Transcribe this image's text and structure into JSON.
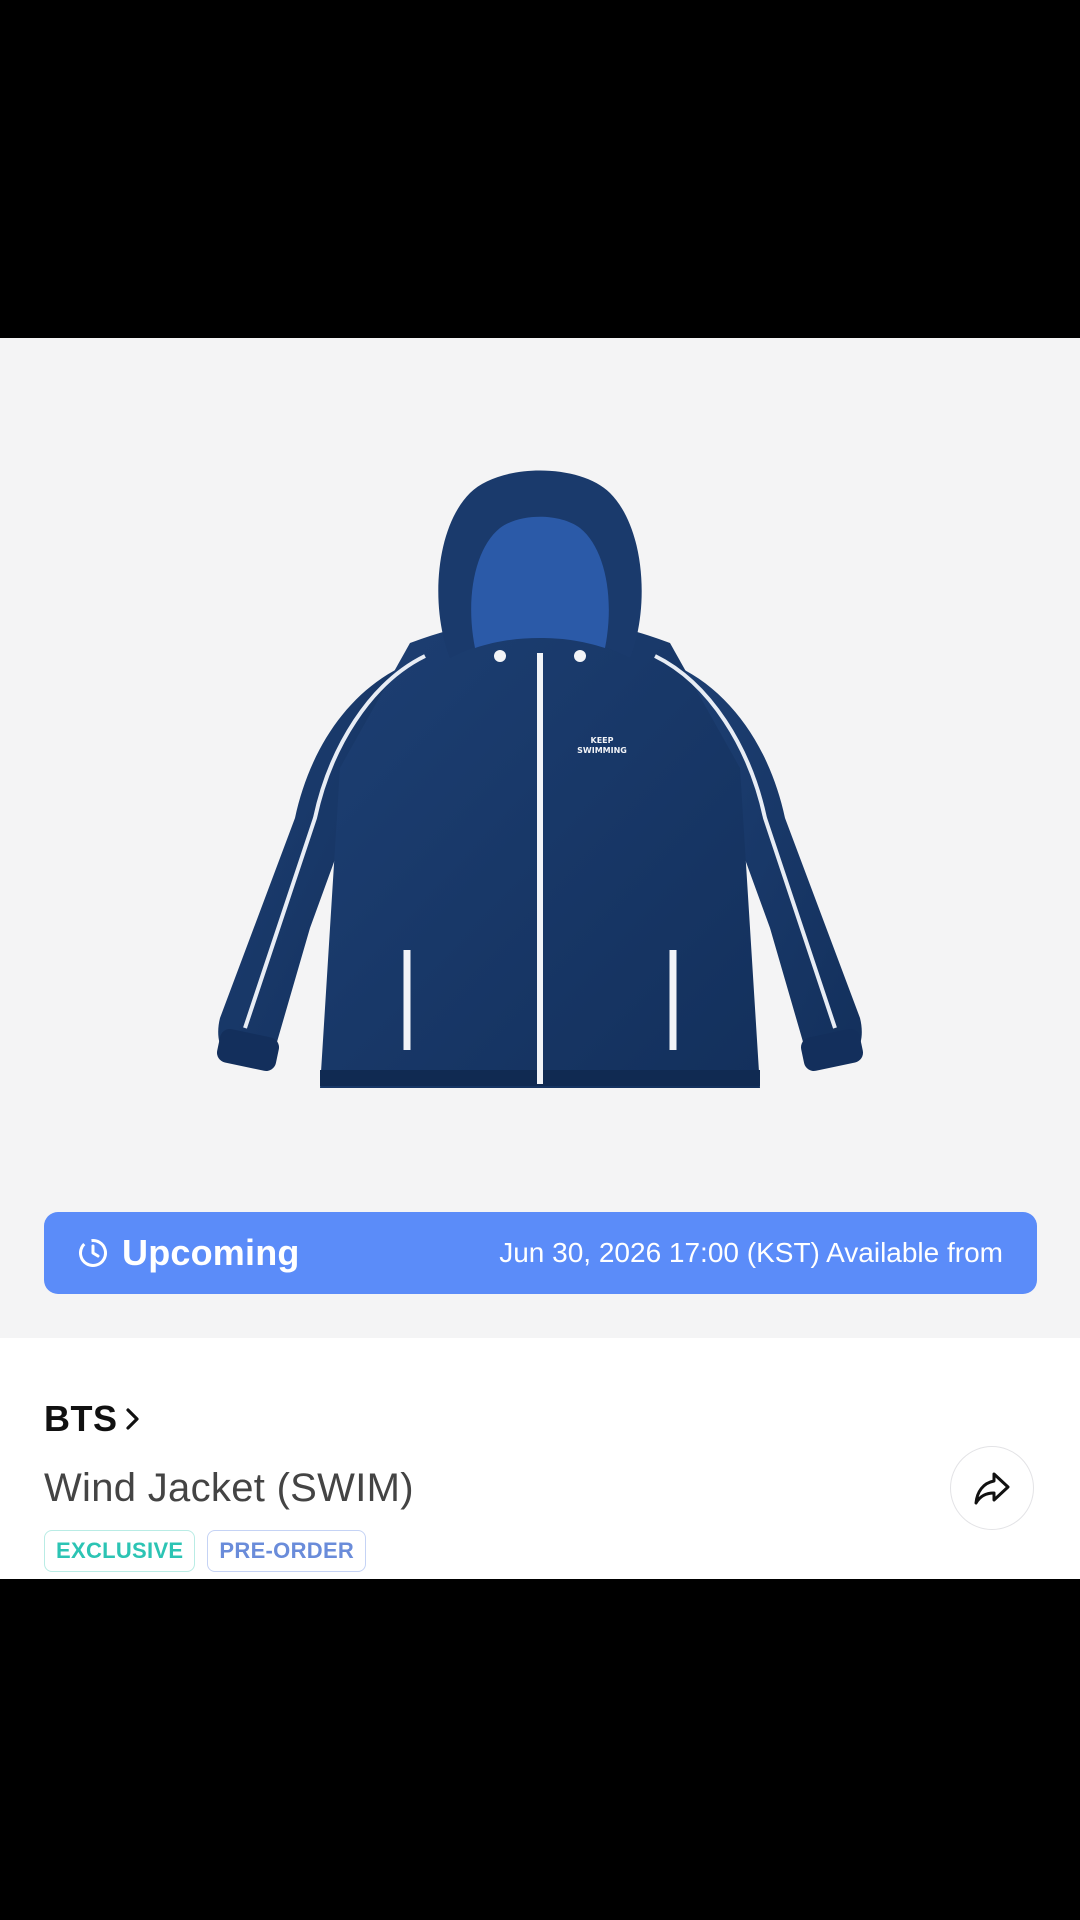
{
  "banner": {
    "status_label": "Upcoming",
    "availability_text": "Jun 30, 2026 17:00 (KST) Available from",
    "icon": "clock-icon",
    "color": "#5b8cf9"
  },
  "product": {
    "artist": "BTS",
    "title": "Wind Jacket (SWIM)",
    "image_print_text": "KEEP SWIMMING",
    "badges": [
      {
        "label": "EXCLUSIVE",
        "color": "#2cc4b4"
      },
      {
        "label": "PRE-ORDER",
        "color": "#6a8cda"
      }
    ]
  },
  "actions": {
    "share_icon": "share-icon"
  }
}
